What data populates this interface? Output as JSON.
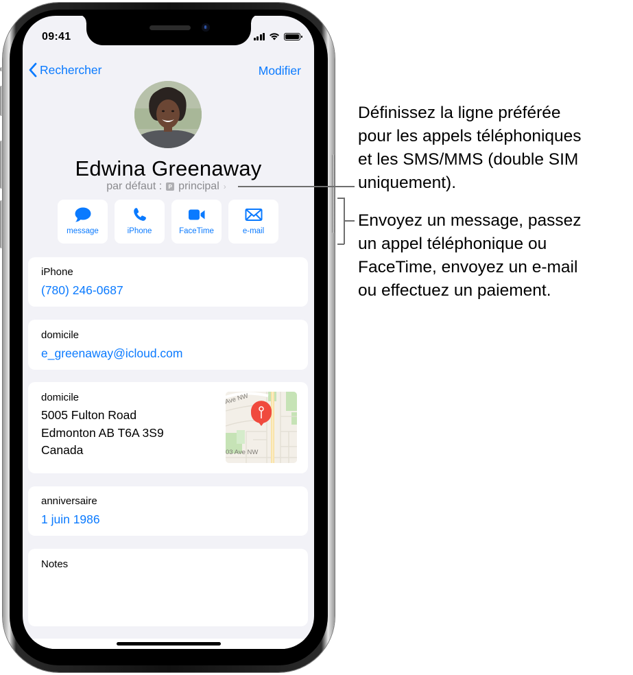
{
  "status_bar": {
    "time": "09:41",
    "icons": [
      "cellular-signal-icon",
      "wifi-icon",
      "battery-icon"
    ]
  },
  "nav": {
    "back_label": "Rechercher",
    "back_icon": "chevron-left-icon",
    "edit_label": "Modifier"
  },
  "contact": {
    "name": "Edwina Greenaway",
    "default_prefix": "par défaut :",
    "sim_badge": "P",
    "default_line": "principal",
    "default_chevron": "›"
  },
  "actions": [
    {
      "label": "message",
      "icon": "message-bubble-icon"
    },
    {
      "label": "iPhone",
      "icon": "phone-icon"
    },
    {
      "label": "FaceTime",
      "icon": "video-camera-icon"
    },
    {
      "label": "e-mail",
      "icon": "envelope-icon"
    }
  ],
  "fields": {
    "phone": {
      "label": "iPhone",
      "value": "(780) 246-0687"
    },
    "email": {
      "label": "domicile",
      "value": "e_greenaway@icloud.com"
    },
    "address": {
      "label": "domicile",
      "lines": [
        "5005 Fulton Road",
        "Edmonton AB T6A 3S9",
        "Canada"
      ],
      "map_labels": [
        "Ave NW",
        "03 Ave NW"
      ]
    },
    "birthday": {
      "label": "anniversaire",
      "value": "1 juin 1986"
    },
    "notes": {
      "label": "Notes",
      "value": ""
    }
  },
  "annotations": {
    "default_line_callout": [
      "Définissez la ligne préférée",
      "pour les appels téléphoniques",
      "et les SMS/MMS (double SIM",
      "uniquement)."
    ],
    "actions_callout": [
      "Envoyez un message, passez",
      "un appel téléphonique ou",
      "FaceTime, envoyez un e-mail",
      "ou effectuez un paiement."
    ]
  },
  "colors": {
    "accent": "#0a7aff",
    "background": "#f2f2f7",
    "card": "#ffffff",
    "secondary_text": "#8a8a8e",
    "map_pin": "#f04a3e"
  }
}
